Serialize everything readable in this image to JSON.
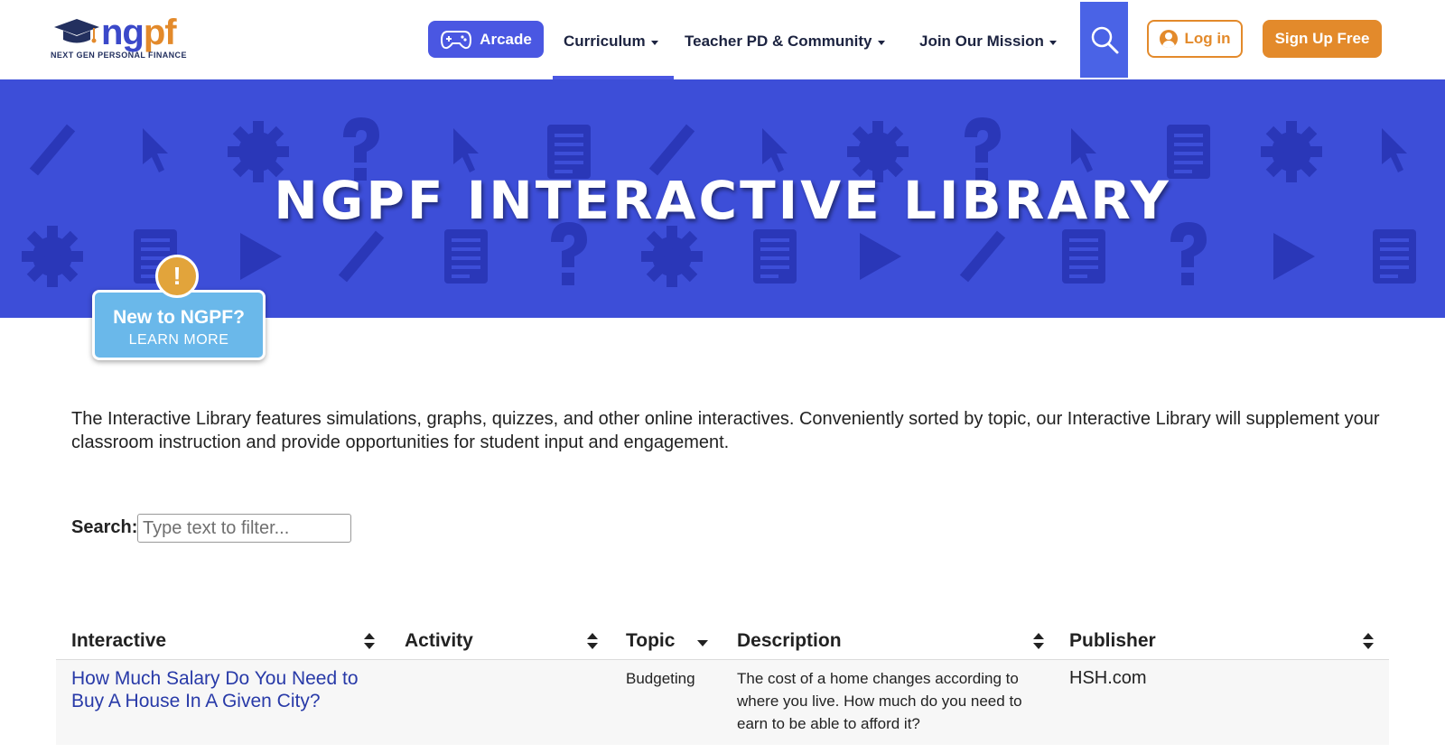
{
  "brand": {
    "wordmark_ng": "ng",
    "wordmark_pf": "pf",
    "tagline": "NEXT GEN PERSONAL FINANCE"
  },
  "nav": {
    "arcade_label": "Arcade",
    "items": [
      {
        "label": "Curriculum"
      },
      {
        "label": "Teacher PD & Community"
      },
      {
        "label": "Join Our Mission"
      }
    ],
    "login_label": "Log in",
    "signup_label": "Sign Up Free"
  },
  "hero": {
    "title": "NGPF INTERACTIVE LIBRARY"
  },
  "new_badge": {
    "title": "New to NGPF?",
    "subtitle": "LEARN MORE",
    "alert_glyph": "!"
  },
  "intro": "The Interactive Library features simulations, graphs, quizzes, and other online interactives. Conveniently sorted by topic, our Interactive Library will supplement your classroom instruction and provide opportunities for student input and engagement.",
  "search": {
    "label": "Search:",
    "placeholder": "Type text to filter...",
    "value": ""
  },
  "table": {
    "columns": [
      "Interactive",
      "Activity",
      "Topic",
      "Description",
      "Publisher"
    ],
    "rows": [
      {
        "interactive_line1": "How Much Salary Do You Need to",
        "interactive_line2": "Buy A House In A Given City?",
        "activity": "",
        "topic": "Budgeting",
        "description_line1": "The cost of a home changes according to",
        "description_line2": "where you live. How much do you need to",
        "description_line3": "earn to be able to afford it?",
        "publisher": "HSH.com"
      }
    ]
  },
  "colors": {
    "brand_blue": "#4a57e2",
    "hero_blue": "#3d4ed8",
    "brand_orange": "#e38a2b",
    "badge_blue": "#6ab8ea",
    "link_blue": "#283aa8"
  },
  "icons": [
    "graduation-cap-icon",
    "gamepad-icon",
    "chevron-down-icon",
    "search-icon",
    "user-circle-icon",
    "alert-icon",
    "sort-icon",
    "sort-desc-icon"
  ]
}
